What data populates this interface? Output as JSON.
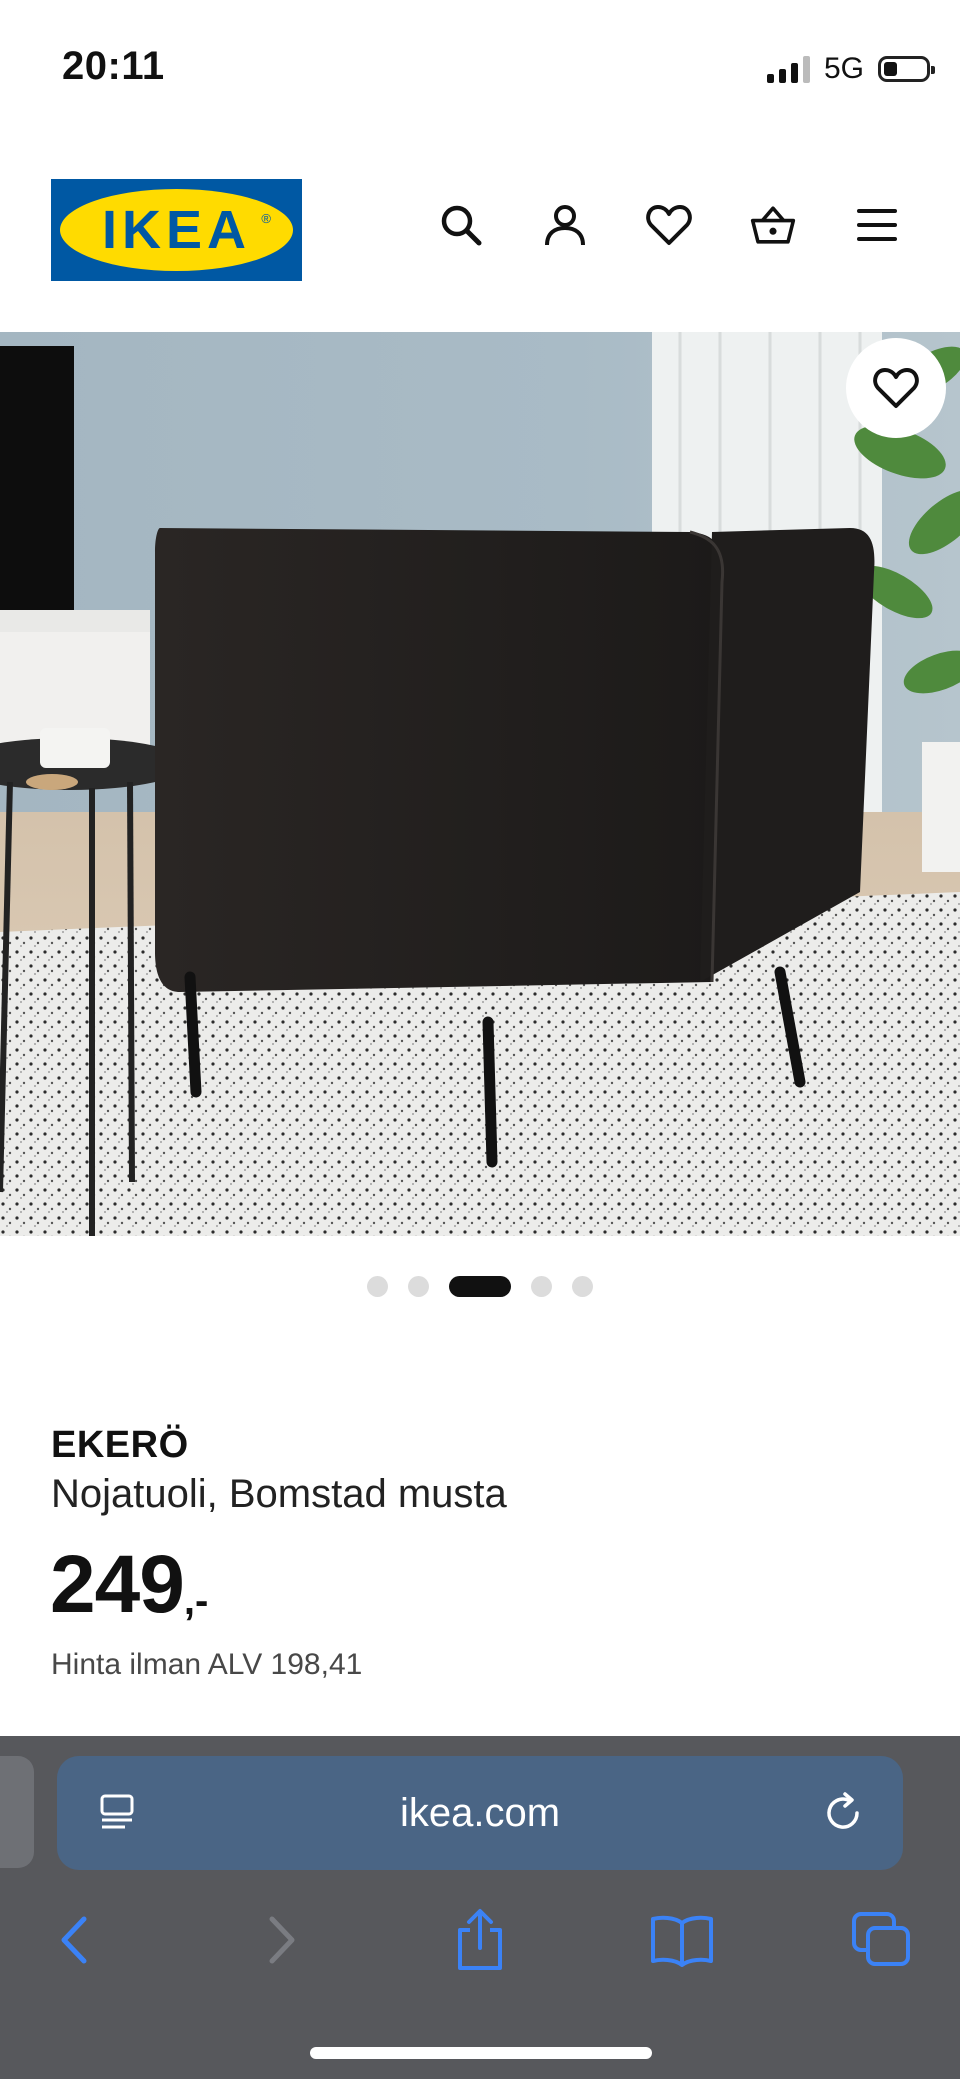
{
  "status": {
    "time": "20:11",
    "network": "5G",
    "battery_level": 0.3
  },
  "header": {
    "logo_text": "IKEA",
    "icons": [
      "search-icon",
      "account-icon",
      "wishlist-icon",
      "cart-icon",
      "menu-icon"
    ]
  },
  "carousel": {
    "count": 5,
    "active_index": 2
  },
  "product": {
    "name": "EKERÖ",
    "description": "Nojatuoli, Bomstad musta",
    "price": "249",
    "price_suffix": ",-",
    "price_note": "Hinta ilman ALV 198,41"
  },
  "browser": {
    "url": "ikea.com"
  },
  "colors": {
    "brand_blue": "#0058a3",
    "brand_yellow": "#ffdb00",
    "browser_accent": "#3b82f6"
  }
}
